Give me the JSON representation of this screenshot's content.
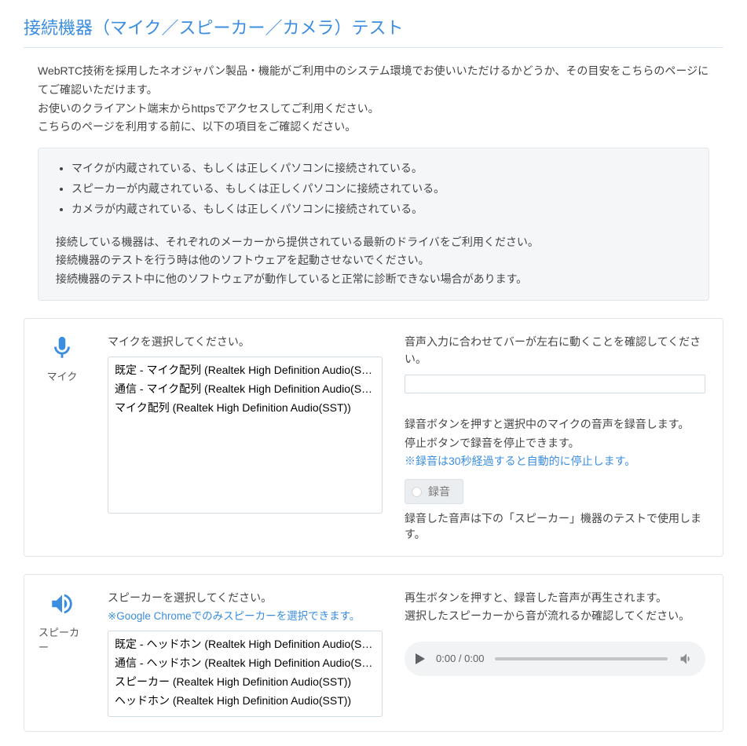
{
  "title": "接続機器（マイク／スピーカー／カメラ）テスト",
  "intro": {
    "p1": "WebRTC技術を採用したネオジャパン製品・機能がご利用中のシステム環境でお使いいただけるかどうか、その目安をこちらのページにてご確認いただけます。",
    "p2": "お使いのクライアント端末からhttpsでアクセスしてご利用ください。",
    "p3": "こちらのページを利用する前に、以下の項目をご確認ください。"
  },
  "checklist": [
    "マイクが内蔵されている、もしくは正しくパソコンに接続されている。",
    "スピーカーが内蔵されている、もしくは正しくパソコンに接続されている。",
    "カメラが内蔵されている、もしくは正しくパソコンに接続されている。"
  ],
  "notes": {
    "n1": "接続している機器は、それぞれのメーカーから提供されている最新のドライバをご利用ください。",
    "n2": "接続機器のテストを行う時は他のソフトウェアを起動させないでください。",
    "n3": "接続機器のテスト中に他のソフトウェアが動作していると正常に診断できない場合があります。"
  },
  "mic": {
    "label": "マイク",
    "prompt": "マイクを選択してください。",
    "options": [
      "既定 - マイク配列 (Realtek High Definition Audio(SST))",
      "通信 - マイク配列 (Realtek High Definition Audio(SST))",
      "マイク配列 (Realtek High Definition Audio(SST))"
    ],
    "meter_prompt": "音声入力に合わせてバーが左右に動くことを確認してください。",
    "rec_desc1": "録音ボタンを押すと選択中のマイクの音声を録音します。",
    "rec_desc2": "停止ボタンで録音を停止できます。",
    "rec_desc3": "※録音は30秒経過すると自動的に停止します。",
    "record_button": "録音",
    "after": "録音した音声は下の「スピーカー」機器のテストで使用します。"
  },
  "speaker": {
    "label": "スピーカー",
    "prompt": "スピーカーを選択してください。",
    "chrome_note": "※Google Chromeでのみスピーカーを選択できます。",
    "options": [
      "既定 - ヘッドホン (Realtek High Definition Audio(SST))",
      "通信 - ヘッドホン (Realtek High Definition Audio(SST))",
      "スピーカー (Realtek High Definition Audio(SST))",
      "ヘッドホン (Realtek High Definition Audio(SST))"
    ],
    "play_desc1": "再生ボタンを押すと、録音した音声が再生されます。",
    "play_desc2": "選択したスピーカーから音が流れるか確認してください。",
    "time": "0:00 / 0:00"
  }
}
